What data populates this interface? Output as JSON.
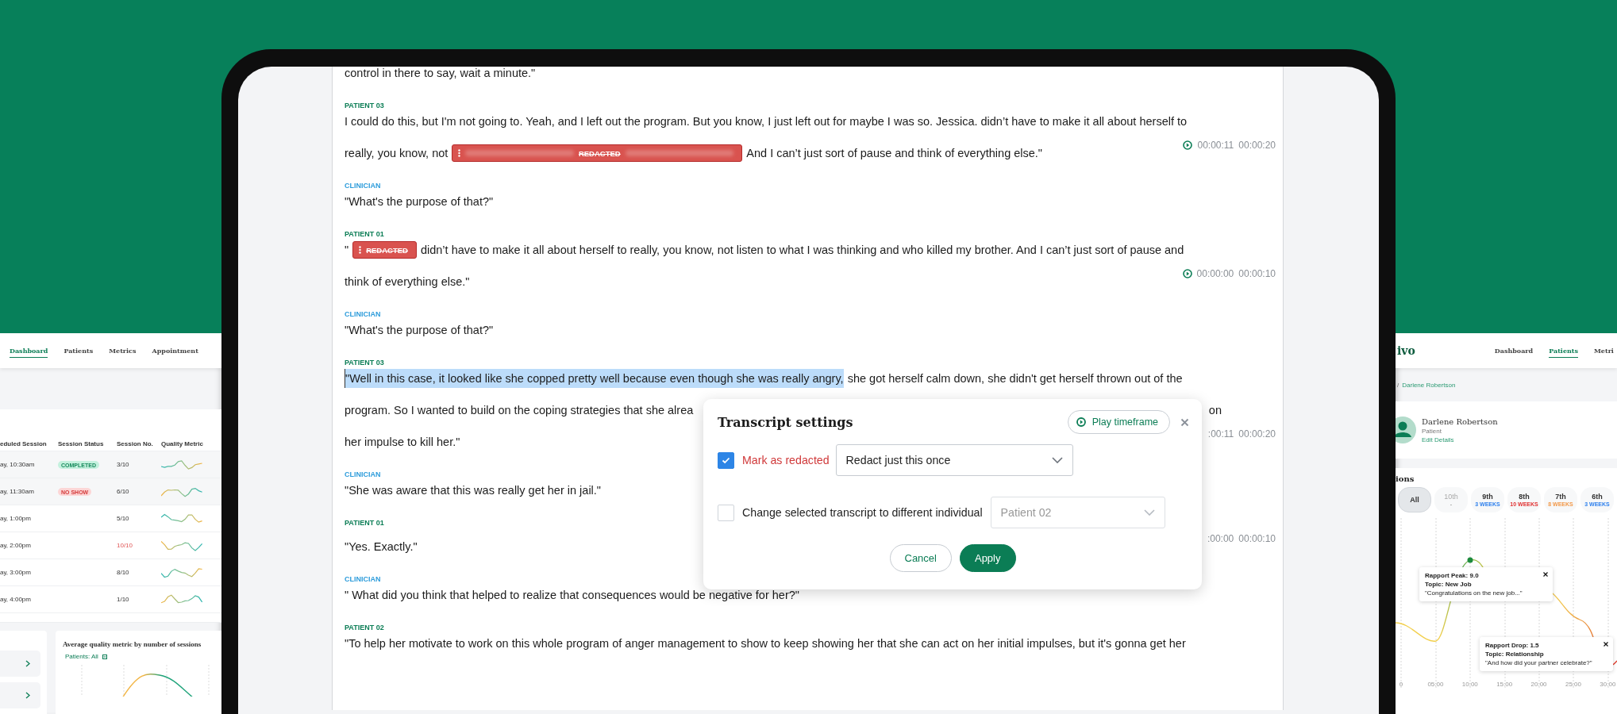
{
  "left_screen": {
    "nav": [
      {
        "label": "Dashboard",
        "selected": true
      },
      {
        "label": "Patients",
        "selected": false
      },
      {
        "label": "Metrics",
        "selected": false
      },
      {
        "label": "Appointment",
        "selected": false
      }
    ],
    "table": {
      "columns": [
        "eduled Session",
        "Session Status",
        "Session No.",
        "Quality Metric"
      ],
      "rows": [
        {
          "session": "ay, 10:30am",
          "status": {
            "label": "COMPLETED",
            "kind": "completed"
          },
          "number": "3/10",
          "alert": false
        },
        {
          "session": "ay, 11:30am",
          "status": {
            "label": "NO SHOW",
            "kind": "no_show"
          },
          "number": "6/10",
          "alert": false
        },
        {
          "session": "ay, 1:00pm",
          "number": "5/10",
          "alert": false
        },
        {
          "session": "ay, 2:00pm",
          "number": "10/10",
          "alert": true
        },
        {
          "session": "ay, 3:00pm",
          "number": "8/10",
          "alert": false
        },
        {
          "session": "ay, 4:00pm",
          "number": "1/10",
          "alert": false
        }
      ]
    },
    "chart_card": {
      "title": "Average quality metric by number of sessions",
      "filter": "Patients: All"
    }
  },
  "transcript": [
    {
      "lines": [
        [
          {
            "kind": "text",
            "text": "control in there to say, wait a minute.\""
          }
        ]
      ]
    },
    {
      "speaker": "PATIENT 03",
      "color": "#0b7d55",
      "lines": [
        [
          {
            "kind": "text",
            "text": "I could do this, but I'm not going to. Yeah, and I left out the program. But you know, I just left out for maybe I was so. Jessica.  didn’t have to make it all about herself to"
          }
        ],
        [
          {
            "kind": "text",
            "text": "really, you know, not"
          },
          {
            "kind": "redaction",
            "label": "REDACTED",
            "blurred_text": true
          },
          {
            "kind": "text",
            "text": "And I can’t just sort of pause and think of everything else.\""
          }
        ]
      ],
      "timestamp": {
        "play_icon": true,
        "start": "00:00:11",
        "end": "00:00:20"
      }
    },
    {
      "speaker": "CLINICIAN",
      "color": "#2d9cdb",
      "lines": [
        [
          {
            "kind": "text",
            "text": "\"What's the purpose of that?\""
          }
        ]
      ]
    },
    {
      "speaker": "PATIENT 01",
      "color": "#0b7d55",
      "lines": [
        [
          {
            "kind": "text",
            "text": "\""
          },
          {
            "kind": "redaction",
            "label": "REDACTED",
            "blurred_text": false
          },
          {
            "kind": "text",
            "text": "didn’t have to make it all about herself to really, you know, not listen to what I was thinking and who killed my brother. And I can’t just sort of pause and"
          }
        ],
        [
          {
            "kind": "text",
            "text": "think of everything else.\""
          }
        ]
      ],
      "timestamp": {
        "play_icon": true,
        "start": "00:00:00",
        "end": "00:00:10"
      }
    },
    {
      "speaker": "CLINICIAN",
      "color": "#2d9cdb",
      "lines": [
        [
          {
            "kind": "text",
            "text": "\"What's the purpose of that?\""
          }
        ]
      ]
    },
    {
      "speaker": "PATIENT 03",
      "color": "#0b7d55",
      "lines": [
        [
          {
            "kind": "highlight",
            "text": "\"Well in this case, it looked like she copped pretty well because even though she was really angry,"
          },
          {
            "kind": "text",
            "text": "she got herself calm down, she didn't get herself thrown out of the"
          }
        ],
        [
          {
            "kind": "text",
            "text": "program. So I wanted to build on the coping strategies that she alrea"
          },
          {
            "kind": "covered"
          },
          {
            "kind": "text",
            "text": "on"
          }
        ],
        [
          {
            "kind": "text",
            "text": "her impulse to kill her.\""
          }
        ]
      ],
      "timestamp": {
        "play_icon": false,
        "start": ":00:11",
        "end": "00:00:20"
      }
    },
    {
      "speaker": "CLINICIAN",
      "color": "#2d9cdb",
      "lines": [
        [
          {
            "kind": "text",
            "text": "\"She was aware that this was really get her in jail.\""
          }
        ]
      ]
    },
    {
      "speaker": "PATIENT 01",
      "color": "#0b7d55",
      "lines": [
        [
          {
            "kind": "text",
            "text": "\"Yes. Exactly.\""
          }
        ]
      ],
      "timestamp": {
        "play_icon": false,
        "start": ":00:00",
        "end": "00:00:10"
      }
    },
    {
      "speaker": "CLINICIAN",
      "color": "#2d9cdb",
      "lines": [
        [
          {
            "kind": "text",
            "text": "\" What did you think that helped to realize that consequences would be negative for her?\""
          }
        ]
      ]
    },
    {
      "speaker": "PATIENT 02",
      "color": "#0b7d55",
      "lines": [
        [
          {
            "kind": "text",
            "text": "\"To help her motivate to work on this whole program of anger management to show to keep showing her that she can act on her initial impulses, but it's gonna get her"
          }
        ]
      ]
    }
  ],
  "dialog": {
    "title": "Transcript settings",
    "play_button": "Play timeframe",
    "options": [
      {
        "kind": "redact",
        "label": "Mark as redacted",
        "checked": true,
        "select": "Redact just this once",
        "select_disabled": false
      },
      {
        "kind": "reassign",
        "label": "Change selected transcript to different individual",
        "checked": false,
        "select": "Patient 02",
        "select_disabled": true
      }
    ],
    "buttons": [
      {
        "label": "Cancel",
        "kind": "secondary"
      },
      {
        "label": "Apply",
        "kind": "primary"
      }
    ]
  },
  "right_screen": {
    "logo": "ivo",
    "nav": [
      {
        "label": "Dashboard",
        "selected": false
      },
      {
        "label": "Patients",
        "selected": true
      },
      {
        "label": "Metri",
        "selected": false
      }
    ],
    "breadcrumb_separator": "/",
    "breadcrumb_current": "Darlene Robertson",
    "patient": {
      "name": "Darlene Robertson",
      "role": "Patient",
      "edit_link": "Edit Details"
    },
    "sessions": {
      "heading": "ions",
      "filters": [
        {
          "label": "All",
          "selected": true,
          "disabled": false
        },
        {
          "label": "10th",
          "note": "-",
          "selected": false,
          "disabled": true
        },
        {
          "label": "9th",
          "note": "3 WEEKS",
          "selected": false,
          "disabled": false,
          "color": "#2f80ed"
        },
        {
          "label": "8th",
          "note": "10 WEEKS",
          "selected": false,
          "disabled": false,
          "color": "#e03131"
        },
        {
          "label": "7th",
          "note": "8 WEEKS",
          "selected": false,
          "disabled": false,
          "color": "#f2994a"
        },
        {
          "label": "6th",
          "note": "3 WEEKS",
          "selected": false,
          "disabled": false,
          "color": "#2f80ed"
        }
      ]
    },
    "timeline": {
      "x_labels": [
        "0",
        "05:00",
        "10:00",
        "15:00",
        "20:00",
        "25:00",
        "30:00"
      ],
      "tooltips": [
        {
          "title": "Rapport Peak: 9.0",
          "topic": "Topic: New Job",
          "quote": "\"Congratulations on the new job...\""
        },
        {
          "title": "Rapport Drop: 1.5",
          "topic": "Topic: Relationship",
          "quote": "\"And how did your partner celebrate?\""
        }
      ]
    }
  }
}
